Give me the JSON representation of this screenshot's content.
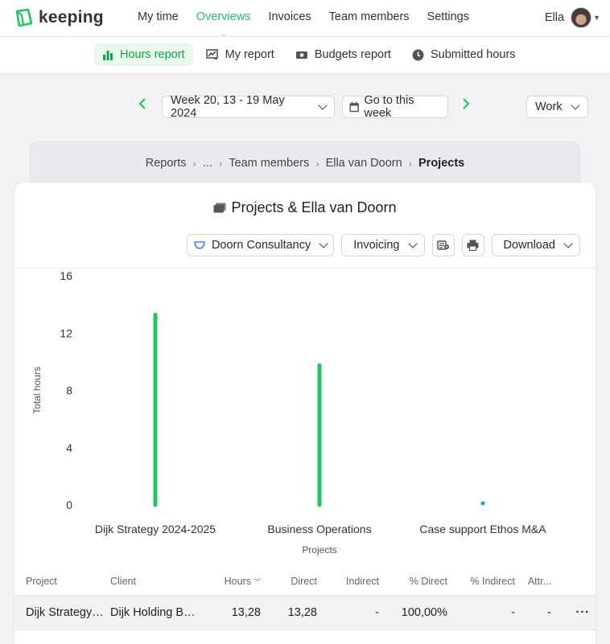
{
  "app": {
    "name": "keeping",
    "brand_color": "#22c55e"
  },
  "nav": {
    "items": [
      {
        "label": "My time"
      },
      {
        "label": "Overviews"
      },
      {
        "label": "Invoices"
      },
      {
        "label": "Team members"
      },
      {
        "label": "Settings"
      }
    ],
    "active": "Overviews",
    "user_name": "Ella"
  },
  "subnav": {
    "items": [
      {
        "label": "Hours report",
        "icon": "bar-chart-icon"
      },
      {
        "label": "My report",
        "icon": "line-chart-icon"
      },
      {
        "label": "Budgets report",
        "icon": "money-icon"
      },
      {
        "label": "Submitted hours",
        "icon": "clock-icon"
      }
    ],
    "active": "Hours report"
  },
  "week": {
    "label": "Week 20, 13 - 19 May 2024",
    "go_to_week": "Go to this week",
    "mode": "Work"
  },
  "breadcrumb": {
    "items": [
      "Reports",
      "...",
      "Team members",
      "Ella van Doorn",
      "Projects"
    ]
  },
  "report": {
    "title": "Projects & Ella van Doorn",
    "filter_org": "Doorn Consultancy",
    "filter_invoicing": "Invoicing",
    "download_label": "Download"
  },
  "chart_data": {
    "type": "bar",
    "categories": [
      "Dijk Strategy 2024-2025",
      "Business Operations",
      "Case support Ethos M&A"
    ],
    "values": [
      13.28,
      9.75,
      0.05
    ],
    "xlabel": "Projects",
    "ylabel": "Total hours",
    "ylim": [
      0,
      16
    ],
    "yticks": [
      0,
      4,
      8,
      12,
      16
    ],
    "color": "#22c55e",
    "grid": false
  },
  "table": {
    "columns": [
      "Project",
      "Client",
      "Hours",
      "Direct",
      "Indirect",
      "% Direct",
      "% Indirect",
      "Attr..."
    ],
    "rows": [
      {
        "project": "Dijk Strategy ...",
        "client": "Dijk Holding B.V.",
        "hours": "13,28",
        "direct": "13,28",
        "indirect": "-",
        "pdirect": "100,00%",
        "pindirect": "-",
        "attr": "-"
      }
    ]
  }
}
